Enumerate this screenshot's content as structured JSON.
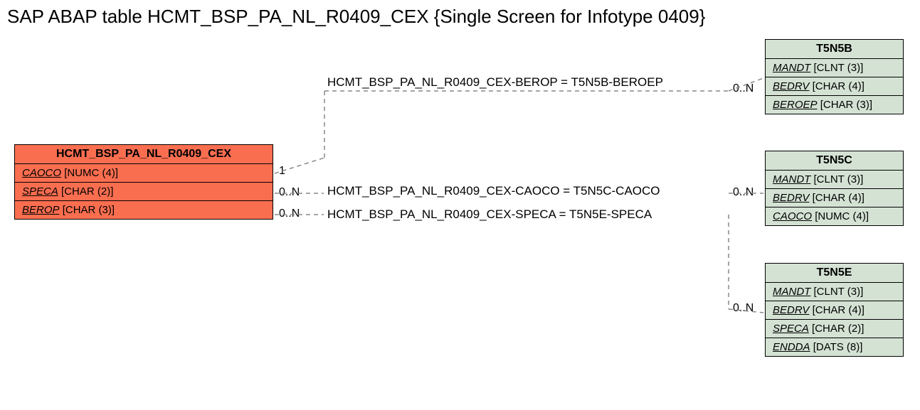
{
  "title": "SAP ABAP table HCMT_BSP_PA_NL_R0409_CEX {Single Screen for Infotype 0409}",
  "main": {
    "name": "HCMT_BSP_PA_NL_R0409_CEX",
    "fields": [
      {
        "fname": "CAOCO",
        "ftype": "[NUMC (4)]"
      },
      {
        "fname": "SPECA",
        "ftype": "[CHAR (2)]"
      },
      {
        "fname": "BEROP",
        "ftype": "[CHAR (3)]"
      }
    ]
  },
  "refs": {
    "t5n5b": {
      "name": "T5N5B",
      "fields": [
        {
          "fname": "MANDT",
          "ftype": "[CLNT (3)]"
        },
        {
          "fname": "BEDRV",
          "ftype": "[CHAR (4)]"
        },
        {
          "fname": "BEROEP",
          "ftype": "[CHAR (3)]"
        }
      ]
    },
    "t5n5c": {
      "name": "T5N5C",
      "fields": [
        {
          "fname": "MANDT",
          "ftype": "[CLNT (3)]"
        },
        {
          "fname": "BEDRV",
          "ftype": "[CHAR (4)]"
        },
        {
          "fname": "CAOCO",
          "ftype": "[NUMC (4)]"
        }
      ]
    },
    "t5n5e": {
      "name": "T5N5E",
      "fields": [
        {
          "fname": "MANDT",
          "ftype": "[CLNT (3)]"
        },
        {
          "fname": "BEDRV",
          "ftype": "[CHAR (4)]"
        },
        {
          "fname": "SPECA",
          "ftype": "[CHAR (2)]"
        },
        {
          "fname": "ENDDA",
          "ftype": "[DATS (8)]"
        }
      ]
    }
  },
  "relations": {
    "r1": "HCMT_BSP_PA_NL_R0409_CEX-BEROP = T5N5B-BEROEP",
    "r2": "HCMT_BSP_PA_NL_R0409_CEX-CAOCO = T5N5C-CAOCO",
    "r3": "HCMT_BSP_PA_NL_R0409_CEX-SPECA = T5N5E-SPECA"
  },
  "cards": {
    "left1": "1",
    "left2": "0..N",
    "left3": "0..N",
    "right1": "0..N",
    "right2": "0..N",
    "right3": "0..N"
  }
}
